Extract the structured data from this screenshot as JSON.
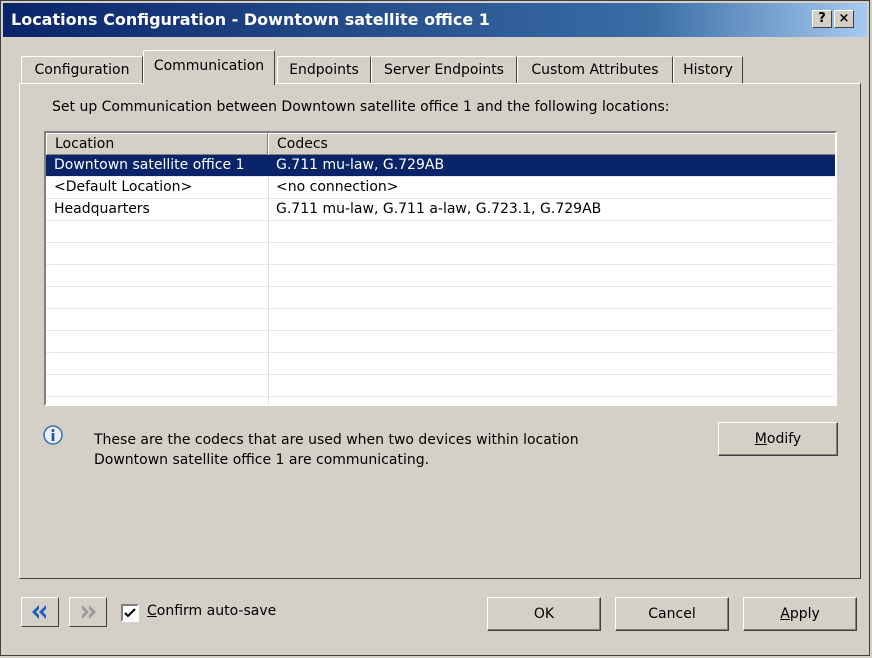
{
  "window": {
    "title": "Locations Configuration - Downtown satellite office 1",
    "help_button": "?",
    "close_button": "×"
  },
  "tabs": [
    {
      "label": "Configuration",
      "active": false
    },
    {
      "label": "Communication",
      "active": true
    },
    {
      "label": "Endpoints",
      "active": false
    },
    {
      "label": "Server Endpoints",
      "active": false
    },
    {
      "label": "Custom Attributes",
      "active": false
    },
    {
      "label": "History",
      "active": false
    }
  ],
  "communication": {
    "intro": "Set up Communication between Downtown satellite office 1 and the following locations:",
    "columns": [
      "Location",
      "Codecs"
    ],
    "rows": [
      {
        "location": "Downtown satellite office 1",
        "codecs": "G.711 mu-law, G.729AB",
        "selected": true
      },
      {
        "location": "<Default Location>",
        "codecs": "<no connection>",
        "selected": false
      },
      {
        "location": "Headquarters",
        "codecs": "G.711 mu-law, G.711 a-law, G.723.1, G.729AB",
        "selected": false
      }
    ],
    "info_line1": "These are the codecs that are used when two devices within location",
    "info_line2": "Downtown satellite office 1 are communicating.",
    "modify_label": "Modify",
    "modify_mnemonic": "M",
    "modify_rest": "odify"
  },
  "footer": {
    "confirm_autosave": {
      "checked": true,
      "label": "Confirm auto-save",
      "mnemonic": "C",
      "rest": "onfirm auto-save"
    },
    "ok_label": "OK",
    "cancel_label": "Cancel",
    "apply_label": "Apply",
    "apply_mnemonic": "A",
    "apply_rest": "pply"
  },
  "icons": {
    "back": "double-left-arrow-icon",
    "forward": "double-right-arrow-icon",
    "info": "info-icon",
    "check": "checkmark-icon"
  },
  "colors": {
    "titlebar": "#0a246a",
    "selection": "#0a246a",
    "face": "#d4d0c8",
    "back_arrow": "#1f5fc0"
  }
}
